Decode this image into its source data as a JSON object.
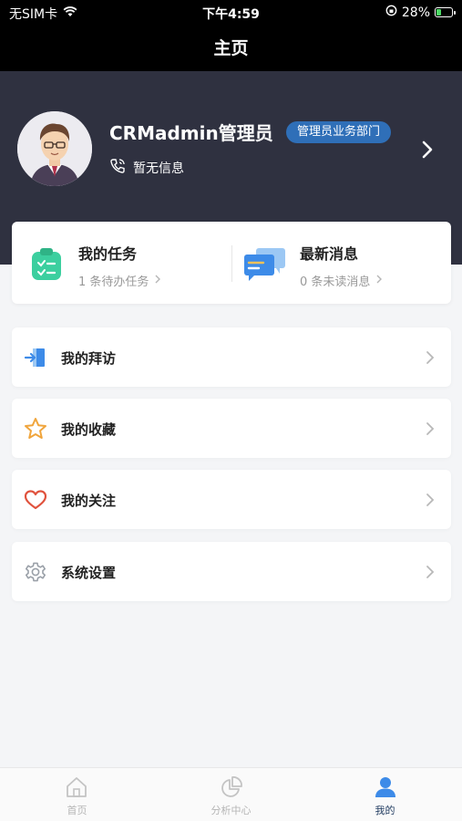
{
  "status_bar": {
    "carrier": "无SIM卡",
    "time": "下午4:59",
    "battery_text": "28%",
    "battery_level": 0.28
  },
  "nav": {
    "title": "主页"
  },
  "profile": {
    "name": "CRMadmin管理员",
    "department": "管理员业务部门",
    "phone_text": "暂无信息"
  },
  "quick": {
    "tasks": {
      "title": "我的任务",
      "subtitle": "1 条待办任务"
    },
    "messages": {
      "title": "最新消息",
      "subtitle": "0 条未读消息"
    }
  },
  "menu": [
    {
      "label": "我的拜访",
      "icon": "visit-door-icon"
    },
    {
      "label": "我的收藏",
      "icon": "star-icon"
    },
    {
      "label": "我的关注",
      "icon": "heart-icon"
    },
    {
      "label": "系统设置",
      "icon": "gear-icon"
    }
  ],
  "tabs": [
    {
      "label": "首页",
      "icon": "home-icon",
      "active": false
    },
    {
      "label": "分析中心",
      "icon": "pie-chart-icon",
      "active": false
    },
    {
      "label": "我的",
      "icon": "user-icon",
      "active": true
    }
  ],
  "colors": {
    "header_bg": "#2f3140",
    "badge_bg": "#2f6fb8",
    "task_icon": "#3ccf9f",
    "message_icon": "#3d8be8",
    "star": "#f0a53c",
    "heart": "#e0523d",
    "active_tab": "#3d8be8"
  }
}
